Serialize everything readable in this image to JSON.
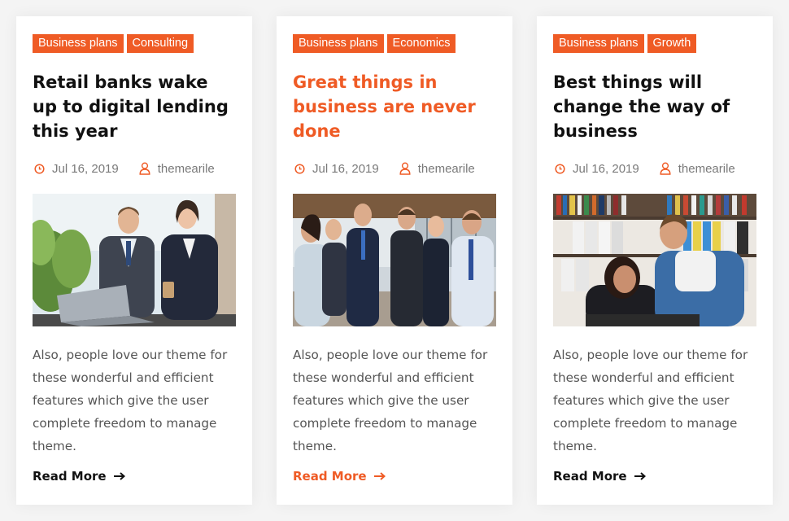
{
  "colors": {
    "accent": "#ef5b25",
    "title": "#111111",
    "meta": "#7a7a7a"
  },
  "posts": [
    {
      "tags": [
        "Business plans",
        "Consulting"
      ],
      "title": "Retail banks wake up to digital lending this year",
      "date": "Jul 16, 2019",
      "author": "themearile",
      "image": "two-business-people-laptop-photo",
      "excerpt": "Also, people love our theme for these wonderful and efficient features which give the user complete freedom to manage theme.",
      "read_more": "Read More"
    },
    {
      "tags": [
        "Business plans",
        "Economics"
      ],
      "title": "Great things in business are never done",
      "date": "Jul 16, 2019",
      "author": "themearile",
      "image": "business-team-meeting-photo",
      "excerpt": "Also, people love our theme for these wonderful and efficient features which give the user complete freedom to manage theme.",
      "read_more": "Read More"
    },
    {
      "tags": [
        "Business plans",
        "Growth"
      ],
      "title": "Best things will change the way of business",
      "date": "Jul 16, 2019",
      "author": "themearile",
      "image": "office-coworkers-computer-photo",
      "excerpt": "Also, people love our theme for these wonderful and efficient features which give the user complete freedom to manage theme.",
      "read_more": "Read More"
    }
  ]
}
